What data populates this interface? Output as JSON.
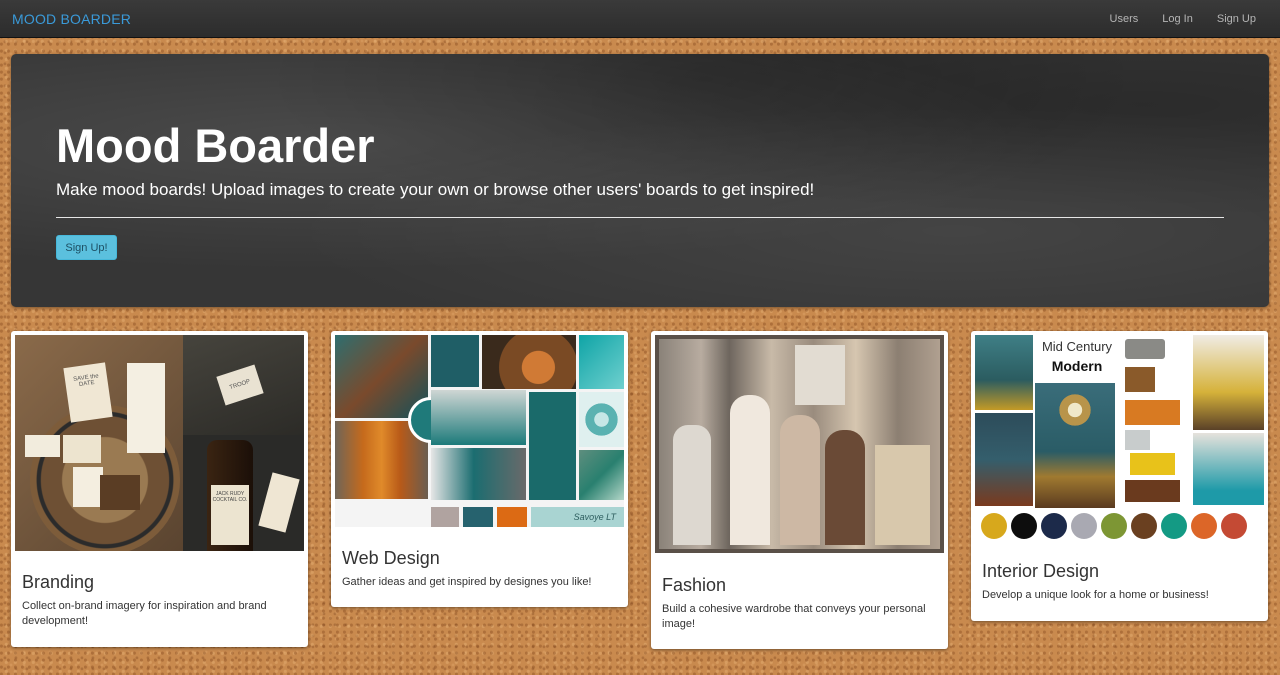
{
  "navbar": {
    "brand": "MOOD BOARDER",
    "links": [
      "Users",
      "Log In",
      "Sign Up"
    ]
  },
  "hero": {
    "title": "Mood Boarder",
    "subtitle": "Make mood boards! Upload images to create your own or browse other users' boards to get inspired!",
    "button": "Sign Up!"
  },
  "cards": [
    {
      "title": "Branding",
      "description": "Collect on-brand imagery for inspiration and brand development!",
      "image_text": [
        "SAVE the DATE",
        "JACK RUDY COCKTAIL CO.",
        "TROOP"
      ]
    },
    {
      "title": "Web Design",
      "description": "Gather ideas and get inspired by designes you like!",
      "image_text": [
        "Savoye LT"
      ]
    },
    {
      "title": "Fashion",
      "description": "Build a cohesive wardrobe that conveys your personal image!"
    },
    {
      "title": "Interior Design",
      "description": "Develop a unique look for a home or business!",
      "image_text": [
        "Mid Century",
        "Modern"
      ]
    }
  ],
  "colors": {
    "brand": "#3a9ad9",
    "button": "#5bc0de",
    "navbar": "#2c2c2c",
    "cork": "#c98a4e"
  }
}
